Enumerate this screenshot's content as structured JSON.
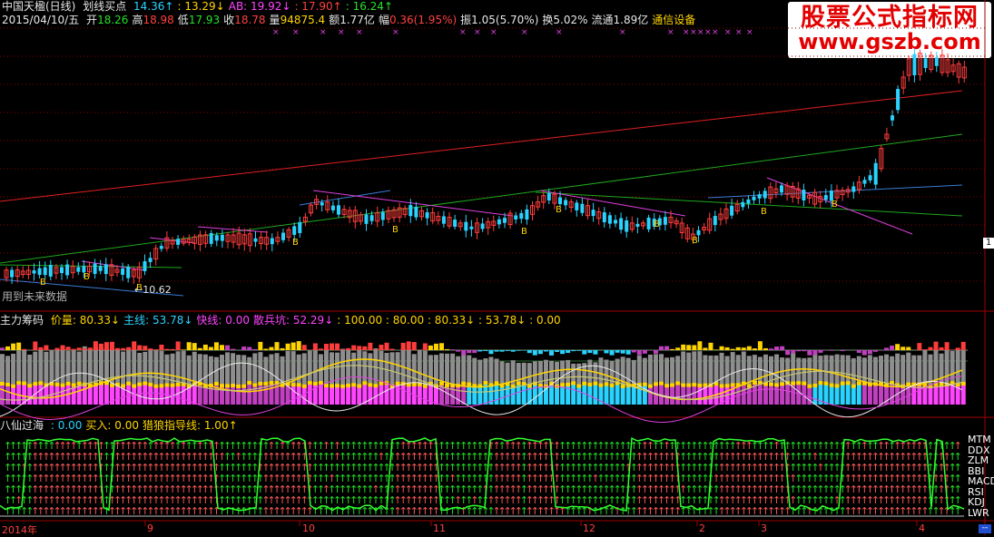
{
  "colors": {
    "up": "#ff3c3c",
    "down": "#2ad3ff",
    "grid": "#8b0000",
    "long_red": "#e02020",
    "long_green": "#1ea81e",
    "long_blue": "#3a7bd5",
    "magenta": "#e040e0",
    "yellow": "#ffd400",
    "arrow_green": "#25e025",
    "arrow_red": "#ff5a5a"
  },
  "price_panel": {
    "title": "中国天楹(日线)",
    "indicator": "划线买点",
    "ind_values": [
      {
        "text": "14.36↑",
        "color": "cyan"
      },
      {
        "text": ": 13.29↓",
        "color": "yellow"
      },
      {
        "text": "AB: 19.92↓",
        "color": "magenta"
      },
      {
        "text": ": 17.90↑",
        "color": "red"
      },
      {
        "text": ": 16.24↑",
        "color": "green"
      }
    ],
    "date": "2015/04/10/五",
    "quote": [
      {
        "label": "开",
        "value": "18.26",
        "color": "green"
      },
      {
        "label": "高",
        "value": "18.98",
        "color": "red"
      },
      {
        "label": "低",
        "value": "17.93",
        "color": "green"
      },
      {
        "label": "收",
        "value": "18.78",
        "color": "red"
      },
      {
        "label": "量",
        "value": "94875.4",
        "color": "yellow"
      },
      {
        "label": "额",
        "value": "1.77亿",
        "color": "white"
      },
      {
        "label": "幅",
        "value": "0.36(1.95%)",
        "color": "red"
      },
      {
        "label": "振",
        "value": "1.05(5.70%)",
        "color": "white"
      },
      {
        "label": "换",
        "value": "5.02%",
        "color": "white"
      },
      {
        "label": "流通",
        "value": "1.89亿",
        "color": "white"
      },
      {
        "label": "",
        "value": "通信设备",
        "color": "yellow"
      }
    ],
    "low_label": "10.62",
    "future_data": "用到未来数据",
    "buy_marker": "B",
    "price_marker": "1"
  },
  "watermark": {
    "line1": "股票公式指标网",
    "line2": "www.gszb.com"
  },
  "mid_panel": {
    "title": "主力筹码",
    "values": [
      {
        "text": "价量: 80.33↓",
        "color": "yellow"
      },
      {
        "text": "主线: 53.78↓",
        "color": "cyan"
      },
      {
        "text": "快线: 0.00",
        "color": "magenta"
      },
      {
        "text": "散兵坑: 52.29↓",
        "color": "magenta"
      },
      {
        "text": ": 100.00 : 80.00 : 80.33↓ : 53.78↓ : 0.00",
        "color": "yellow"
      }
    ]
  },
  "bottom_panel": {
    "title": "八仙过海",
    "values": [
      {
        "text": ": 0.00",
        "color": "cyan"
      },
      {
        "text": "买入: 0.00",
        "color": "yellow"
      },
      {
        "text": "猎狼指导线: 1.00↑",
        "color": "yellow"
      }
    ],
    "indicators": [
      "MTM",
      "DDX",
      "ZLM",
      "BBI",
      "MACD",
      "RSI",
      "KDJ",
      "LWR"
    ]
  },
  "x_axis": {
    "labels": [
      "2014年",
      "9",
      "10",
      "11",
      "12",
      "2",
      "3",
      "4"
    ]
  },
  "chart_data": {
    "type": "candlestick",
    "title": "中国天楹(日线)",
    "xlabel": "",
    "ylabel": "",
    "x_range": [
      "2014",
      "2015/04/10"
    ],
    "last_close": 18.78,
    "last_open": 18.26,
    "last_high": 18.98,
    "last_low": 17.93,
    "period_low": 10.62
  }
}
